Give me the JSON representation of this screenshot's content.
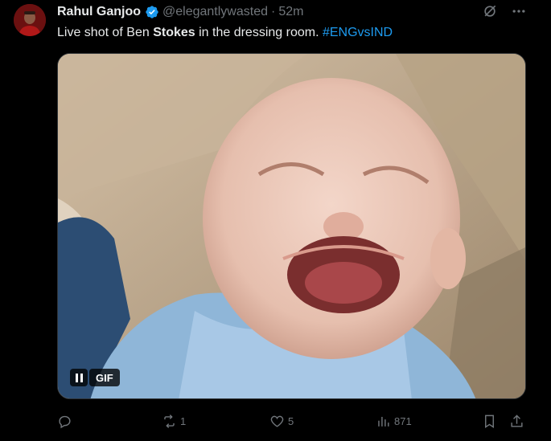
{
  "tweet": {
    "author_name": "Rahul Ganjoo",
    "handle": "@elegantlywasted",
    "separator": "·",
    "time": "52m",
    "text_before": "Live shot of Ben ",
    "text_bold": "Stokes",
    "text_after": " in the dressing room. ",
    "hashtag": "#ENGvsIND",
    "media_badge": "GIF"
  },
  "actions": {
    "reply_count": "",
    "retweet_count": "1",
    "like_count": "5",
    "views_count": "871"
  },
  "icons": {
    "header": [
      "grok-icon",
      "more-icon"
    ],
    "actions": [
      "reply-icon",
      "retweet-icon",
      "like-icon",
      "views-icon",
      "bookmark-icon",
      "share-icon"
    ]
  },
  "colors": {
    "background": "#000000",
    "text": "#e7e9ea",
    "muted": "#71767b",
    "link": "#1d9bf0",
    "verified": "#1d9bf0"
  }
}
